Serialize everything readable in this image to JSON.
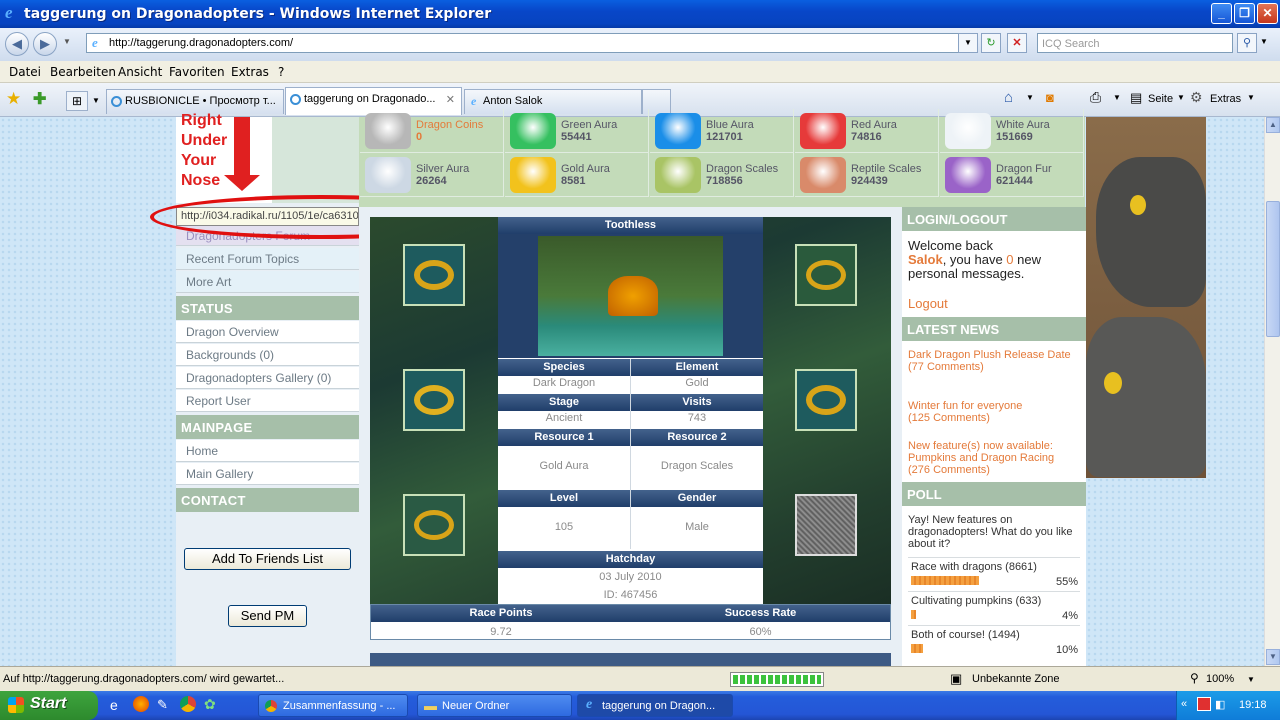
{
  "window": {
    "title": "taggerung on Dragonadopters - Windows Internet Explorer",
    "min": "_",
    "max": "❐",
    "close": "✕"
  },
  "address": {
    "url": "http://taggerung.dragonadopters.com/",
    "search_placeholder": "ICQ Search"
  },
  "menu": [
    "Datei",
    "Bearbeiten",
    "Ansicht",
    "Favoriten",
    "Extras",
    "?"
  ],
  "tabs": [
    {
      "label": "RUSBIONICLE • Просмотр т..."
    },
    {
      "label": "taggerung on Dragonado..."
    },
    {
      "label": "Anton Salok"
    }
  ],
  "commands": {
    "page": "Seite",
    "tools": "Extras"
  },
  "left": {
    "sign": [
      "Right",
      "Under",
      "Your",
      "Nose"
    ],
    "tooltip_url": "http://i034.radikal.ru/1105/1e/ca6310ae2093.png",
    "forum": "Dragonadopters Forum",
    "recent": "Recent Forum Topics",
    "more_art": "More Art",
    "status_hdr": "STATUS",
    "overview": "Dragon Overview",
    "backgrounds": "Backgrounds (0)",
    "gallery": "Dragonadopters Gallery (0)",
    "report": "Report User",
    "main_hdr": "MAINPAGE",
    "home": "Home",
    "main_gallery": "Main Gallery",
    "contact_hdr": "CONTACT",
    "add_friend": "Add To Friends List",
    "send_pm": "Send PM"
  },
  "resources": [
    {
      "name": "Dragon Coins",
      "value": "0",
      "color": "#b7b7b7"
    },
    {
      "name": "Green Aura",
      "value": "55441",
      "color": "#35c060"
    },
    {
      "name": "Blue Aura",
      "value": "121701",
      "color": "#1a8ee8"
    },
    {
      "name": "Red Aura",
      "value": "74816",
      "color": "#e63a3a"
    },
    {
      "name": "White Aura",
      "value": "151669",
      "color": "#eef3f7"
    },
    {
      "name": "Silver Aura",
      "value": "26264",
      "color": "#cdd8e4"
    },
    {
      "name": "Gold Aura",
      "value": "8581",
      "color": "#f2c21c"
    },
    {
      "name": "Dragon Scales",
      "value": "718856",
      "color": "#a9c465"
    },
    {
      "name": "Reptile Scales",
      "value": "924439",
      "color": "#d98a6a"
    },
    {
      "name": "Dragon Fur",
      "value": "621444",
      "color": "#9a63c8"
    }
  ],
  "dragon": {
    "name": "Toothless",
    "species_lbl": "Species",
    "species": "Dark Dragon",
    "element_lbl": "Element",
    "element": "Gold",
    "stage_lbl": "Stage",
    "stage": "Ancient",
    "visits_lbl": "Visits",
    "visits": "743",
    "res1_lbl": "Resource 1",
    "res1": "Gold Aura",
    "res2_lbl": "Resource 2",
    "res2": "Dragon Scales",
    "level_lbl": "Level",
    "level": "105",
    "gender_lbl": "Gender",
    "gender": "Male",
    "hatch_lbl": "Hatchday",
    "hatch": "03 July 2010",
    "id": "ID: 467456",
    "race_lbl": "Race Points",
    "race": "9.72",
    "success_lbl": "Success Rate",
    "success": "60%"
  },
  "right": {
    "login_hdr": "LOGIN/LOGOUT",
    "welcome": "Welcome back",
    "user": "Salok",
    "msg_pre": ", you have ",
    "msg_count": "0",
    "msg_post": " new personal messages.",
    "logout": "Logout",
    "news_hdr": "LATEST NEWS",
    "news": [
      {
        "title": "Dark Dragon Plush Release Date",
        "comments": "(77 Comments)"
      },
      {
        "title": "Winter fun for everyone",
        "comments": "(125 Comments)"
      },
      {
        "title": "New feature(s) now available: Pumpkins and Dragon Racing",
        "comments": "(276 Comments)"
      }
    ],
    "poll_hdr": "POLL",
    "poll_q": "Yay! New features on dragonadopters! What do you like about it?",
    "poll": [
      {
        "label": "Race with dragons (8661)",
        "pct": "55%",
        "frac": 0.55
      },
      {
        "label": "Cultivating pumpkins (633)",
        "pct": "4%",
        "frac": 0.04
      },
      {
        "label": "Both of course! (1494)",
        "pct": "10%",
        "frac": 0.1
      }
    ]
  },
  "status": {
    "text": "Auf http://taggerung.dragonadopters.com/ wird gewartet...",
    "zone": "Unbekannte Zone",
    "zoom": "100%"
  },
  "taskbar": {
    "start": "Start",
    "tasks": [
      "Zusammenfassung - ...",
      "Neuer Ordner",
      "taggerung on Dragon..."
    ],
    "clock": "19:18"
  }
}
